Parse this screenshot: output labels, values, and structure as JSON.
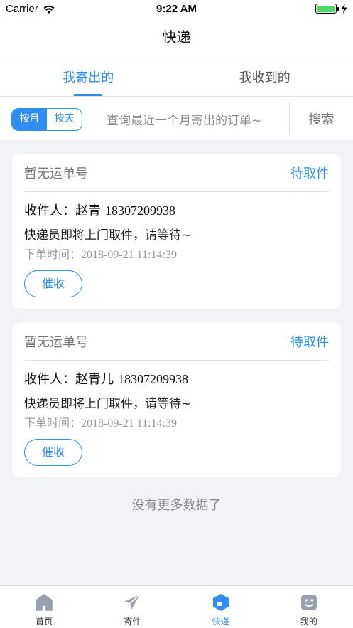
{
  "status_bar": {
    "carrier": "Carrier",
    "time": "9:22 AM"
  },
  "nav": {
    "title": "快递"
  },
  "tabs": [
    {
      "label": "我寄出的",
      "active": true
    },
    {
      "label": "我收到的",
      "active": false
    }
  ],
  "filter": {
    "toggle": [
      {
        "label": "按月",
        "active": true
      },
      {
        "label": "按天",
        "active": false
      }
    ],
    "hint": "查询最近一个月寄出的订单~",
    "search_label": "搜索"
  },
  "orders": [
    {
      "tracking": "暂无运单号",
      "status": "待取件",
      "recipient_label": "收件人：",
      "recipient_name": "赵青",
      "phone": "18307209938",
      "message": "快递员即将上门取件，请等待~",
      "time_label": "下单时间：",
      "time": "2018-09-21 11:14:39",
      "action": "催收"
    },
    {
      "tracking": "暂无运单号",
      "status": "待取件",
      "recipient_label": "收件人：",
      "recipient_name": "赵青儿",
      "phone": "18307209938",
      "message": "快递员即将上门取件，请等待~",
      "time_label": "下单时间：",
      "time": "2018-09-21 11:14:39",
      "action": "催收"
    }
  ],
  "footer_note": "没有更多数据了",
  "tab_bar": [
    {
      "label": "首页",
      "icon": "home-icon",
      "active": false
    },
    {
      "label": "寄件",
      "icon": "send-icon",
      "active": false
    },
    {
      "label": "快递",
      "icon": "package-icon",
      "active": true
    },
    {
      "label": "我的",
      "icon": "profile-icon",
      "active": false
    }
  ],
  "colors": {
    "accent": "#2f8ef0",
    "background": "#f2f3f7",
    "battery": "#4cd964"
  }
}
